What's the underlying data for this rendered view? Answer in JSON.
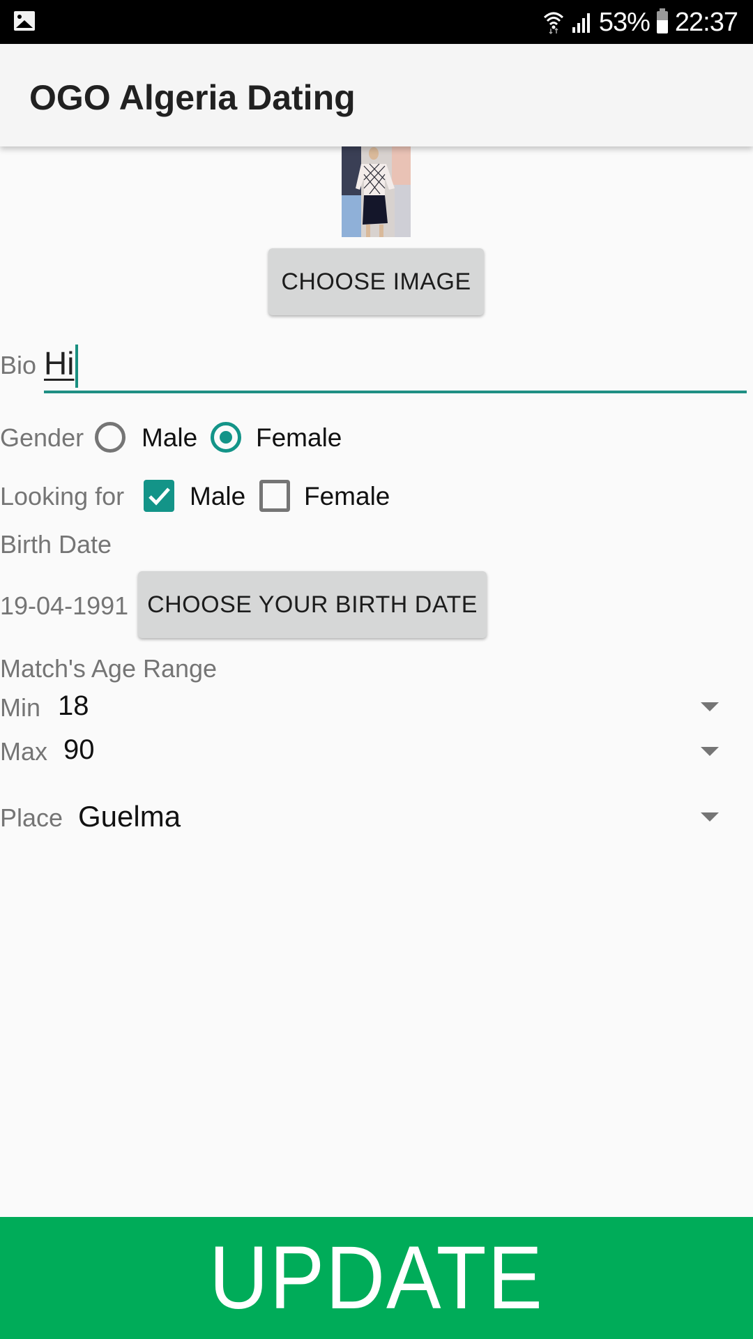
{
  "status_bar": {
    "notification_icon": "gallery-icon",
    "battery_percent": "53%",
    "time": "22:37",
    "icons": [
      "wifi-icon",
      "signal-icon",
      "battery-icon"
    ]
  },
  "toolbar": {
    "title": "OGO Algeria Dating"
  },
  "profile": {
    "image_alt": "Profile photo",
    "choose_image_label": "CHOOSE IMAGE"
  },
  "bio": {
    "label": "Bio",
    "value": "Hi"
  },
  "gender": {
    "label": "Gender",
    "options": [
      {
        "label": "Male",
        "selected": false
      },
      {
        "label": "Female",
        "selected": true
      }
    ]
  },
  "looking_for": {
    "label": "Looking for",
    "options": [
      {
        "label": "Male",
        "checked": true
      },
      {
        "label": "Female",
        "checked": false
      }
    ]
  },
  "birth_date": {
    "label": "Birth Date",
    "value": "19-04-1991",
    "button_label": "CHOOSE YOUR BIRTH DATE"
  },
  "age_range": {
    "label": "Match's Age Range",
    "min_label": "Min",
    "min_value": "18",
    "max_label": "Max",
    "max_value": "90"
  },
  "place": {
    "label": "Place",
    "value": "Guelma"
  },
  "update_label": "UPDATE",
  "colors": {
    "accent": "#139488",
    "update_bg": "#00ac59",
    "button_bg": "#d6d7d7"
  }
}
